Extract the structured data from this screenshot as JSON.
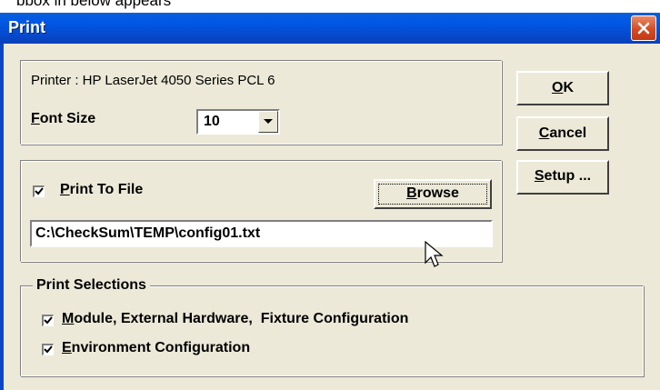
{
  "behind_window_text": "bbox in below appears",
  "window": {
    "title": "Print"
  },
  "printer": {
    "label": "Printer : HP LaserJet 4050 Series PCL 6"
  },
  "font_size": {
    "label_u": "F",
    "label_rest": "ont Size",
    "value": "10"
  },
  "print_to_file": {
    "label_u": "P",
    "label_rest": "rint To File",
    "checked": true,
    "path": "C:\\CheckSum\\TEMP\\config01.txt"
  },
  "browse": {
    "u": "B",
    "rest": "rowse"
  },
  "buttons": {
    "ok": {
      "u": "O",
      "rest": "K"
    },
    "cancel": {
      "u": "C",
      "rest": "ancel"
    },
    "setup": {
      "u": "S",
      "rest": "etup ..."
    }
  },
  "print_selections": {
    "title": "Print Selections",
    "items": [
      {
        "u": "M",
        "rest": "odule, External Hardware,  Fixture Configuration",
        "checked": true
      },
      {
        "u": "E",
        "rest": "nvironment Configuration",
        "checked": true
      }
    ]
  },
  "icons": {
    "close": "close-x-icon",
    "dropdown": "triangle-down-icon",
    "checkmark": "check-icon",
    "cursor": "arrow-cursor-icon"
  },
  "colors": {
    "titlebar": "#0058e6",
    "close_button": "#d64a22",
    "dialog_bg": "#ece9d8"
  }
}
